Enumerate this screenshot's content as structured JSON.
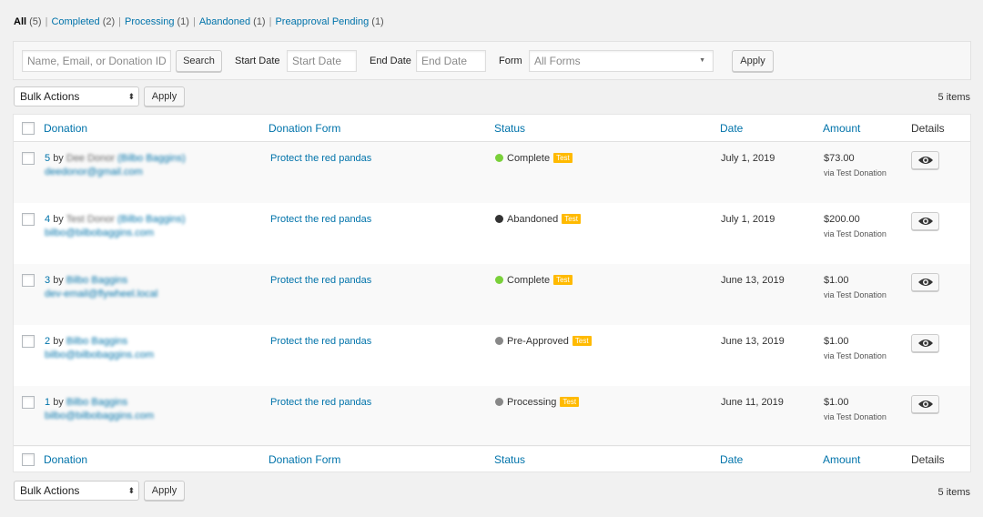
{
  "views": [
    {
      "label": "All",
      "count": "(5)"
    },
    {
      "label": "Completed",
      "count": "(2)"
    },
    {
      "label": "Processing",
      "count": "(1)"
    },
    {
      "label": "Abandoned",
      "count": "(1)"
    },
    {
      "label": "Preapproval Pending",
      "count": "(1)"
    }
  ],
  "separator": "|",
  "filters": {
    "search_placeholder": "Name, Email, or Donation ID",
    "search_button": "Search",
    "start_label": "Start Date",
    "start_placeholder": "Start Date",
    "end_label": "End Date",
    "end_placeholder": "End Date",
    "form_label": "Form",
    "form_value": "All Forms",
    "apply": "Apply"
  },
  "bulk": {
    "label": "Bulk Actions",
    "apply": "Apply",
    "items": "5 items"
  },
  "columns": {
    "donation": "Donation",
    "form": "Donation Form",
    "status": "Status",
    "date": "Date",
    "amount": "Amount",
    "details": "Details"
  },
  "status_colors": {
    "complete": "#7ad03a",
    "abandoned": "#333333",
    "preapproved": "#888888",
    "processing": "#888888"
  },
  "badge_color": "#ffba00",
  "rows": [
    {
      "id": "5",
      "by": "by",
      "name": "Dee Donor",
      "alias": "(Bilbo Baggins)",
      "email": "deedonor@gmail.com",
      "form": "Protect the red pandas",
      "status": "Complete",
      "badge": "Test",
      "date": "July 1, 2019",
      "amount": "$73.00",
      "via": "via Test Donation"
    },
    {
      "id": "4",
      "by": "by",
      "name": "Test Donor",
      "alias": "(Bilbo Baggins)",
      "email": "bilbo@bilbobaggins.com",
      "form": "Protect the red pandas",
      "status": "Abandoned",
      "badge": "Test",
      "date": "July 1, 2019",
      "amount": "$200.00",
      "via": "via Test Donation"
    },
    {
      "id": "3",
      "by": "by",
      "name": "Bilbo Baggins",
      "alias": "",
      "email": "dev-email@flywheel.local",
      "form": "Protect the red pandas",
      "status": "Complete",
      "badge": "Test",
      "date": "June 13, 2019",
      "amount": "$1.00",
      "via": "via Test Donation"
    },
    {
      "id": "2",
      "by": "by",
      "name": "Bilbo Baggins",
      "alias": "",
      "email": "bilbo@bilbobaggins.com",
      "form": "Protect the red pandas",
      "status": "Pre-Approved",
      "badge": "Test",
      "date": "June 13, 2019",
      "amount": "$1.00",
      "via": "via Test Donation"
    },
    {
      "id": "1",
      "by": "by",
      "name": "Bilbo Baggins",
      "alias": "",
      "email": "bilbo@bilbobaggins.com",
      "form": "Protect the red pandas",
      "status": "Processing",
      "badge": "Test",
      "date": "June 11, 2019",
      "amount": "$1.00",
      "via": "via Test Donation"
    }
  ]
}
